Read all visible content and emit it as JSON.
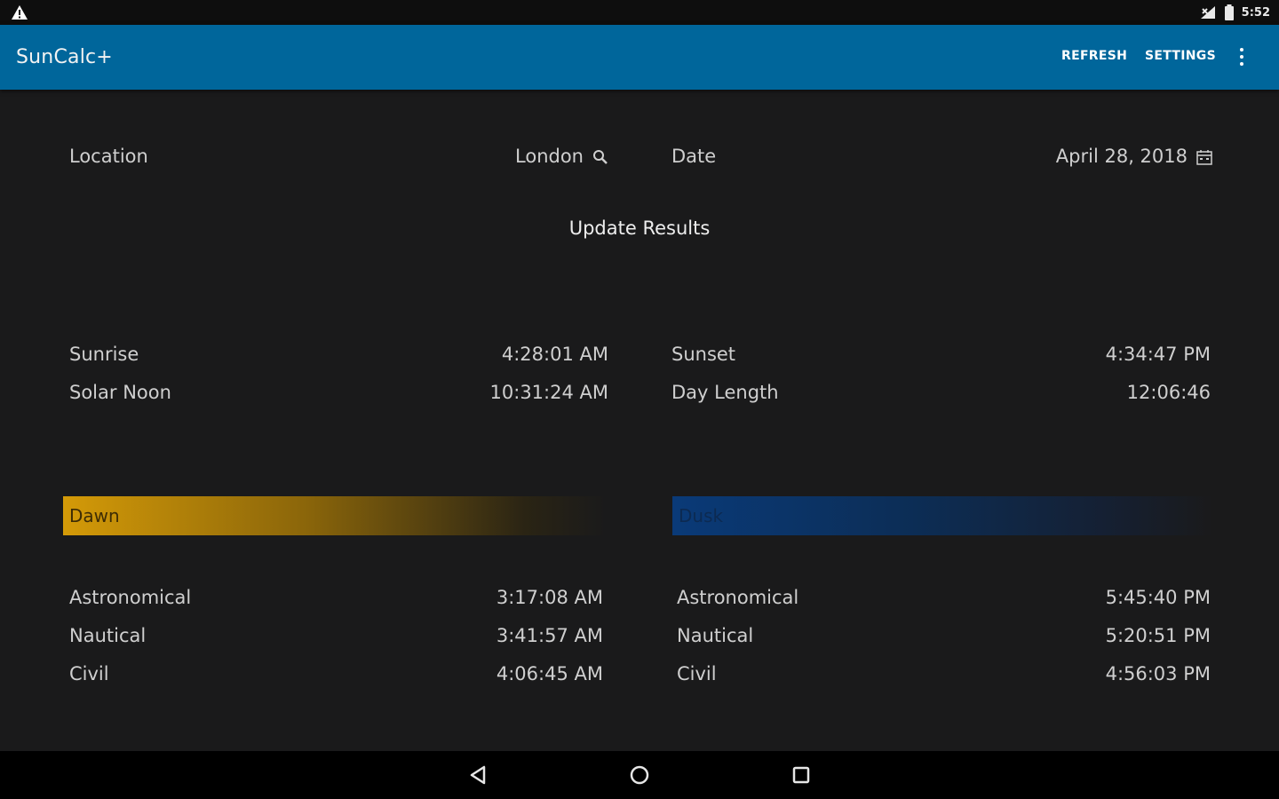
{
  "status_bar": {
    "time": "5:52"
  },
  "app_bar": {
    "title": "SunCalc+",
    "refresh_label": "REFRESH",
    "settings_label": "SETTINGS"
  },
  "query": {
    "location_label": "Location",
    "location_value": "London",
    "date_label": "Date",
    "date_value": "April 28, 2018",
    "update_label": "Update Results"
  },
  "results": {
    "sunrise_label": "Sunrise",
    "sunrise_value": "4:28:01 AM",
    "solar_noon_label": "Solar Noon",
    "solar_noon_value": "10:31:24 AM",
    "sunset_label": "Sunset",
    "sunset_value": "4:34:47 PM",
    "day_length_label": "Day Length",
    "day_length_value": "12:06:46"
  },
  "dawn": {
    "band_label": "Dawn",
    "color": "#d49a08",
    "rows": [
      {
        "label": "Astronomical",
        "value": "3:17:08 AM"
      },
      {
        "label": "Nautical",
        "value": "3:41:57 AM"
      },
      {
        "label": "Civil",
        "value": "4:06:45 AM"
      }
    ]
  },
  "dusk": {
    "band_label": "Dusk",
    "color": "#0a3a78",
    "rows": [
      {
        "label": "Astronomical",
        "value": "5:45:40 PM"
      },
      {
        "label": "Nautical",
        "value": "5:20:51 PM"
      },
      {
        "label": "Civil",
        "value": "4:56:03 PM"
      }
    ]
  },
  "colors": {
    "app_bar": "#00669b",
    "background": "#1a1a1b"
  }
}
